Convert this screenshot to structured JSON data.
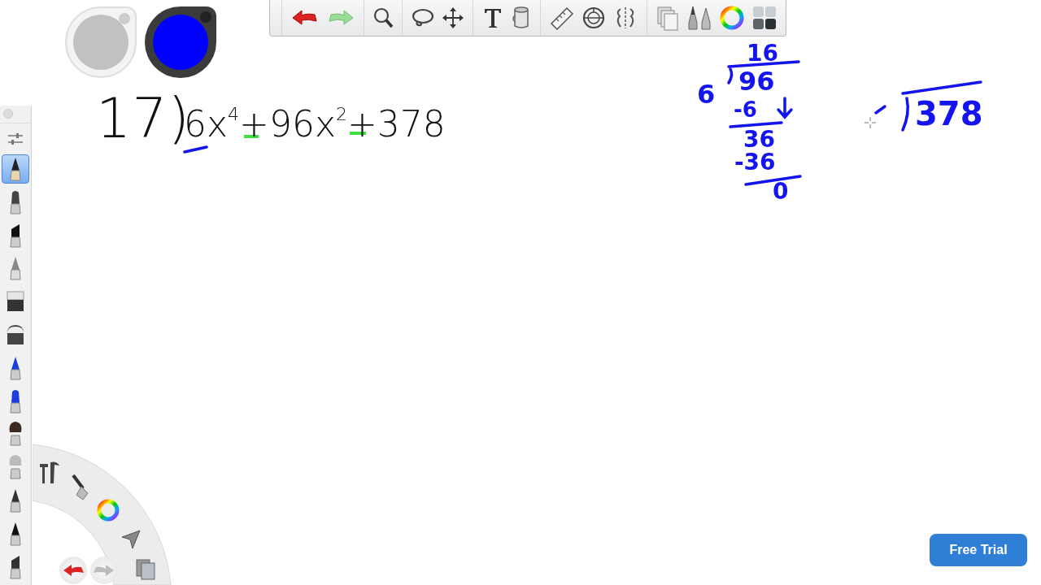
{
  "color_pucks": [
    {
      "color": "#c2c0c0",
      "selected": false
    },
    {
      "color": "#0000ff",
      "selected": true
    }
  ],
  "brush_palette": [
    {
      "selected": true
    },
    {
      "selected": false
    },
    {
      "selected": false
    },
    {
      "selected": false
    },
    {
      "selected": false
    },
    {
      "selected": false
    },
    {
      "selected": false
    },
    {
      "selected": false
    },
    {
      "selected": false
    },
    {
      "selected": false
    },
    {
      "selected": false
    },
    {
      "selected": false
    },
    {
      "selected": false
    }
  ],
  "canvas": {
    "problem_number": "17)",
    "expression": "6x$^{4}$+96x$^{2}$+378",
    "division": {
      "quotient": "16",
      "divisor": "6",
      "dividend": "96",
      "subtract_1": "-6",
      "remainder_1": "36",
      "subtract_2": "-36",
      "result": "0"
    },
    "second_division": {
      "dividend": "378"
    }
  },
  "trial_button": "Free Trial"
}
